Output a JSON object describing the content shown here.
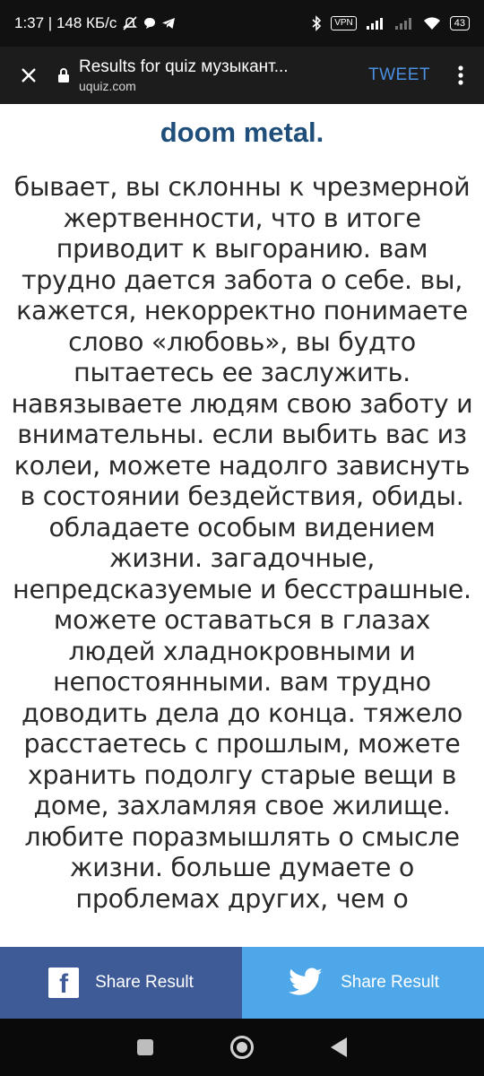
{
  "status_bar": {
    "time_and_speed": "1:37 | 148 КБ/с",
    "vpn": "VPN",
    "battery": "43"
  },
  "browser": {
    "page_title": "Results for quiz музыкант...",
    "domain": "uquiz.com",
    "tweet_label": "TWEET"
  },
  "result": {
    "title": "doom metal.",
    "description": "бывает, вы склонны к чрезмерной жертвенности, что в итоге приводит к выгоранию. вам трудно дается забота о себе. вы, кажется, некорректно понимаете слово «любовь», вы будто пытаетесь ее заслужить. навязываете людям свою заботу и внимательны. если выбить вас из колеи, можете надолго зависнуть в состоянии бездействия, обиды. обладаете особым видением жизни. загадочные, непредсказуемые и бесстрашные. можете оставаться в глазах людей хладнокровными и непостоянными. вам трудно доводить дела до конца. тяжело расстаетесь с прошлым, можете хранить подолгу старые вещи в доме, захламляя свое жилище. любите поразмышлять о смысле жизни. больше думаете о проблемах других, чем о"
  },
  "share": {
    "facebook_label": "Share Result",
    "twitter_label": "Share Result"
  },
  "colors": {
    "title": "#1f4e7a",
    "facebook": "#3e5b98",
    "twitter": "#4da7e8",
    "tweet_link": "#4a8fe0"
  }
}
